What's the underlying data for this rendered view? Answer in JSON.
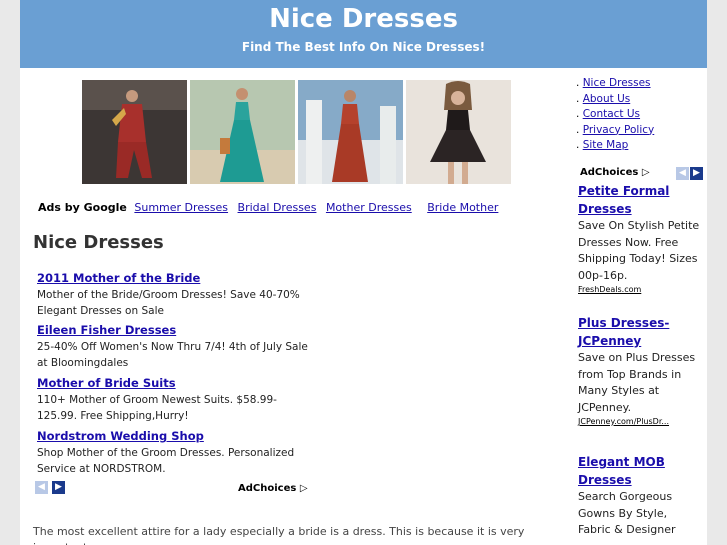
{
  "header": {
    "title": "Nice Dresses",
    "tagline": "Find The Best Info On Nice Dresses!"
  },
  "photos": [
    {
      "icon": "dress-photo-red-salwar"
    },
    {
      "icon": "dress-photo-teal-maxi"
    },
    {
      "icon": "dress-photo-rust-gown"
    },
    {
      "icon": "dress-photo-black-lace"
    }
  ],
  "ad_links": {
    "label": "Ads by Google",
    "links": [
      "Summer Dresses",
      "Bridal Dresses",
      "Mother Dresses",
      "Bride Mother"
    ]
  },
  "main": {
    "heading": "Nice Dresses"
  },
  "ads": [
    {
      "title": "2011 Mother of the Bride",
      "desc": "Mother of the Bride/Groom Dresses! Save 40-70% Elegant Dresses on Sale"
    },
    {
      "title": "Eileen Fisher Dresses",
      "desc": "25-40% Off Women's Now Thru 7/4! 4th of July Sale at Bloomingdales"
    },
    {
      "title": "Mother of Bride Suits",
      "desc": "110+ Mother of Groom Newest Suits. $58.99-125.99. Free Shipping,Hurry!"
    },
    {
      "title": "Nordstrom Wedding Shop",
      "desc": "Shop Mother of the Groom Dresses. Personalized Service at NORDSTROM."
    }
  ],
  "adchoices_label": "AdChoices",
  "body_text": "The most excellent attire for a lady especially a bride is a dress. This is because it is very important",
  "sidebar": {
    "menu": [
      "Nice Dresses",
      "About Us",
      "Contact Us",
      "Privacy Policy",
      "Site Map"
    ],
    "ads": [
      {
        "title": "Petite Formal Dresses",
        "desc": "Save On Stylish Petite Dresses Now. Free Shipping Today! Sizes 00p-16p.",
        "url": "FreshDeals.com"
      },
      {
        "title": "Plus Dresses-JCPenney",
        "desc": "Save on Plus Dresses from Top Brands in Many Styles at JCPenney.",
        "url": "JCPenney.com/PlusDr..."
      },
      {
        "title": "Elegant MOB Dresses",
        "desc": "Search Gorgeous Gowns By Style, Fabric & Designer"
      }
    ]
  },
  "colors": {
    "header_bg": "#6a9fd3",
    "link": "#1a0dab",
    "page_bg": "#e9e9e9"
  }
}
